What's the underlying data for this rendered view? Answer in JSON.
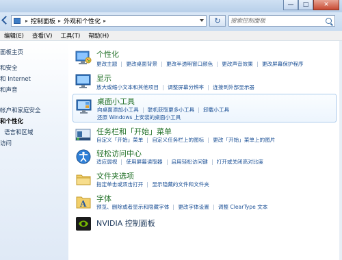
{
  "window": {
    "buttons": {
      "minimize": "—",
      "maximize": "□",
      "close": "✕"
    }
  },
  "address": {
    "crumbs": [
      "控制面板",
      "外观和个性化"
    ],
    "refresh_icon": "refresh-icon"
  },
  "search": {
    "placeholder": "搜索控制面板"
  },
  "menu": [
    "编辑(E)",
    "查看(V)",
    "工具(T)",
    "帮助(H)"
  ],
  "sidebar": {
    "items": [
      "面板主页",
      "和安全",
      "和 Internet",
      "和声音",
      "帐户和家庭安全",
      "和个性化",
      "语言和区域",
      "访问"
    ]
  },
  "categories": [
    {
      "title": "个性化",
      "links": [
        "更改主题",
        "更改桌面背景",
        "更改半透明窗口颜色",
        "更改声音效果",
        "更改屏幕保护程序"
      ]
    },
    {
      "title": "显示",
      "links": [
        "放大或缩小文本和其他项目",
        "调整屏幕分辨率",
        "连接到外部显示器"
      ]
    },
    {
      "title": "桌面小工具",
      "links": [
        "向桌面添加小工具",
        "联机获取更多小工具",
        "卸载小工具"
      ],
      "links2": [
        "还原 Windows 上安装的桌面小工具"
      ]
    },
    {
      "title": "任务栏和「开始」菜单",
      "links": [
        "自定义「开始」菜单",
        "自定义任务栏上的图标",
        "更改「开始」菜单上的图片"
      ]
    },
    {
      "title": "轻松访问中心",
      "links": [
        "适应弱视",
        "使用屏幕读取器",
        "启用轻松访问键",
        "打开或关闭高对比度"
      ]
    },
    {
      "title": "文件夹选项",
      "links": [
        "指定单击或双击打开",
        "显示隐藏的文件和文件夹"
      ]
    },
    {
      "title": "字体",
      "links": [
        "预览、删除或者显示和隐藏字体",
        "更改字体设置",
        "调整 ClearType 文本"
      ]
    },
    {
      "title": "NVIDIA 控制面板"
    }
  ]
}
